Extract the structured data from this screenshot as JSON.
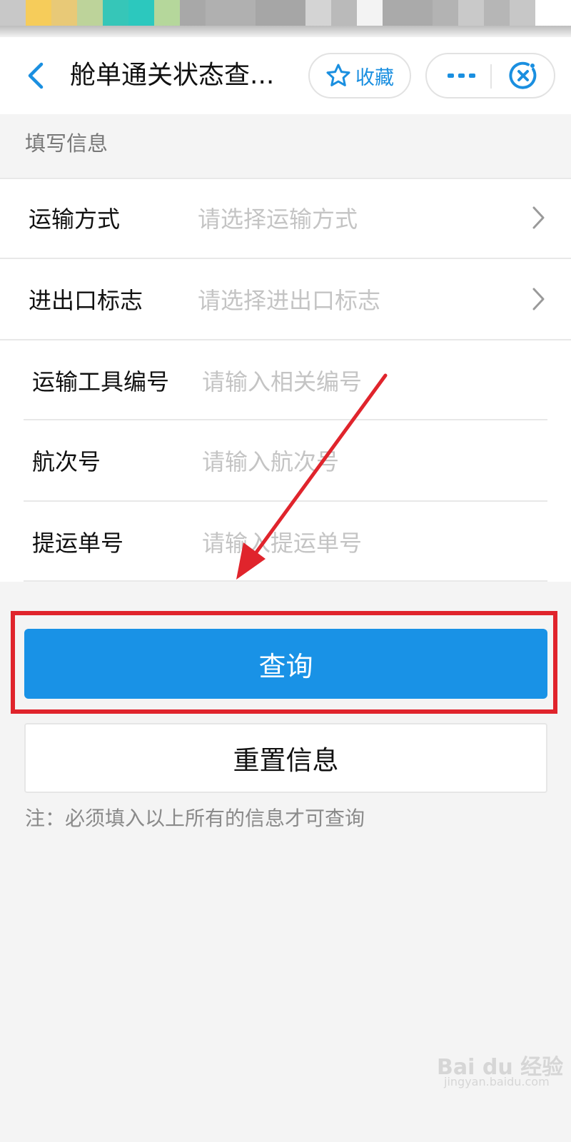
{
  "status_bar": {
    "blocks": [
      {
        "color": "#c8c8c8"
      },
      {
        "color": "#f6cc5a"
      },
      {
        "color": "#e8c977"
      },
      {
        "color": "#bdd39a"
      },
      {
        "color": "#36c6b8"
      },
      {
        "color": "#2cc8be"
      },
      {
        "color": "#b5d79b"
      },
      {
        "color": "#a8a8a8"
      },
      {
        "color": "#b0b0b0"
      },
      {
        "color": "#a6a6a6"
      },
      {
        "color": "#d4d4d4"
      },
      {
        "color": "#bababa"
      },
      {
        "color": "#f3f3f3"
      },
      {
        "color": "#aaaaaa"
      },
      {
        "color": "#b3b3b3"
      },
      {
        "color": "#c9c9c9"
      },
      {
        "color": "#b6b6b6"
      },
      {
        "color": "#c7c7c7"
      },
      {
        "color": "#ffffff"
      }
    ]
  },
  "navbar": {
    "back_icon": "chevron-left-icon",
    "title": "舱单通关状态查...",
    "favorite": {
      "icon": "star-outline-icon",
      "label": "收藏"
    },
    "more_icon": "more-dots-icon",
    "close_icon": "close-circle-icon",
    "accent_color": "#1a8fe0"
  },
  "form": {
    "section_label": "填写信息",
    "fields": [
      {
        "label": "运输方式",
        "placeholder": "请选择运输方式",
        "type": "select"
      },
      {
        "label": "进出口标志",
        "placeholder": "请选择进出口标志",
        "type": "select"
      },
      {
        "label": "运输工具编号",
        "placeholder": "请输入相关编号",
        "type": "input"
      },
      {
        "label": "航次号",
        "placeholder": "请输入航次号",
        "type": "input"
      },
      {
        "label": "提运单号",
        "placeholder": "请输入提运单号",
        "type": "input"
      }
    ]
  },
  "actions": {
    "query_label": "查询",
    "query_color": "#1992e6",
    "reset_label": "重置信息"
  },
  "note": "注：必须填入以上所有的信息才可查询",
  "annotation": {
    "highlight_color": "#e0242c",
    "arrow_color": "#e0242c"
  },
  "watermark": {
    "brand": "Bai du 经验",
    "url": "jingyan.baidu.com"
  }
}
